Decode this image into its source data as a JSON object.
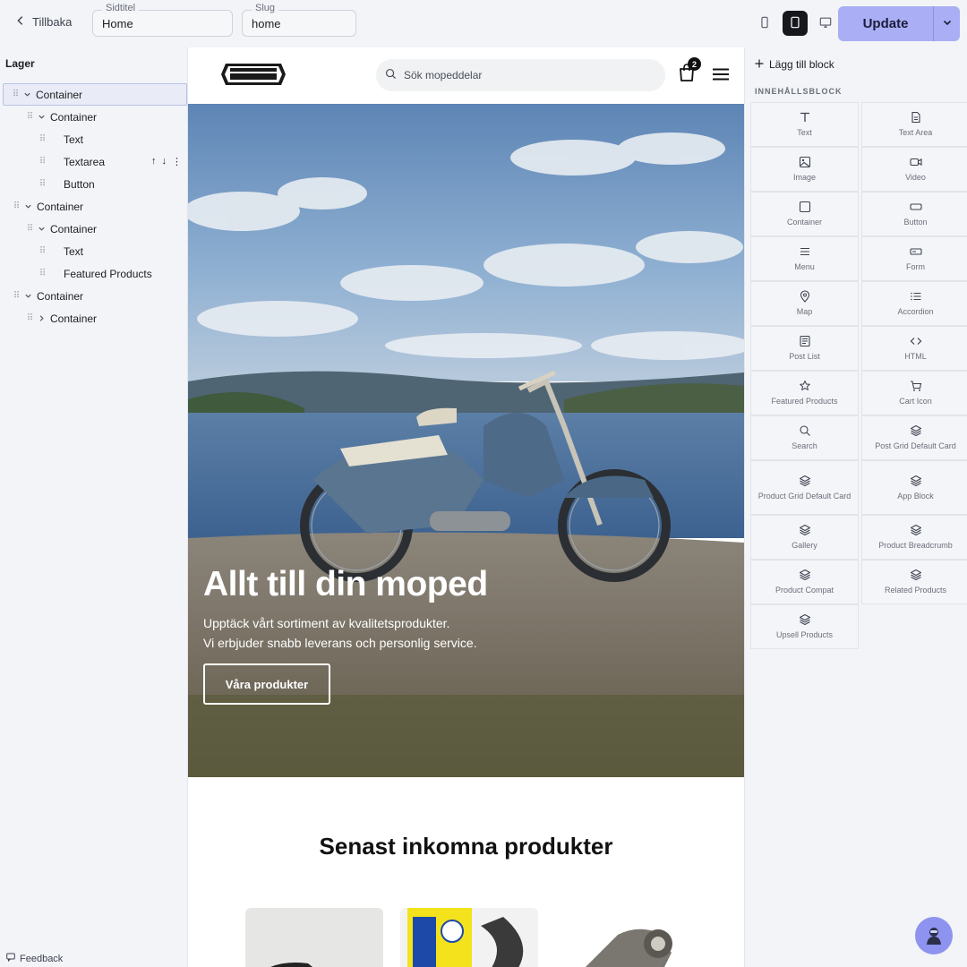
{
  "topbar": {
    "back_label": "Tillbaka",
    "title_field": {
      "label": "Sidtitel",
      "value": "Home"
    },
    "slug_field": {
      "label": "Slug",
      "value": "home"
    },
    "devices": [
      "mobile",
      "tablet",
      "desktop"
    ],
    "active_device": "tablet",
    "update_label": "Update",
    "accent_color": "#a9aef5"
  },
  "layers": {
    "title": "Lager",
    "nodes": [
      {
        "label": "Container",
        "depth": 0,
        "expanded": true,
        "selected": true
      },
      {
        "label": "Container",
        "depth": 1,
        "expanded": true
      },
      {
        "label": "Text",
        "depth": 2
      },
      {
        "label": "Textarea",
        "depth": 2,
        "actions": [
          "↑",
          "↓",
          "⋮"
        ]
      },
      {
        "label": "Button",
        "depth": 2
      },
      {
        "label": "Container",
        "depth": 0,
        "expanded": true
      },
      {
        "label": "Container",
        "depth": 1,
        "expanded": true
      },
      {
        "label": "Text",
        "depth": 2
      },
      {
        "label": "Featured Products",
        "depth": 2
      },
      {
        "label": "Container",
        "depth": 0,
        "expanded": true
      },
      {
        "label": "Container",
        "depth": 1,
        "expanded": false
      }
    ],
    "feedback_label": "Feedback"
  },
  "preview": {
    "search_placeholder": "Sök mopeddelar",
    "cart_count": "2",
    "hero": {
      "title": "Allt till din moped",
      "line1": "Upptäck vårt sortiment av kvalitetsprodukter.",
      "line2": "Vi erbjuder snabb leverans och personlig service.",
      "button": "Våra produkter"
    },
    "section_title": "Senast inkomna produkter"
  },
  "blocks": {
    "add_label": "Lägg till block",
    "heading": "INNEHÅLLSBLOCK",
    "items": [
      {
        "label": "Text",
        "icon": "text-icon"
      },
      {
        "label": "Text Area",
        "icon": "document-icon"
      },
      {
        "label": "Image",
        "icon": "image-icon"
      },
      {
        "label": "Video",
        "icon": "video-icon"
      },
      {
        "label": "Container",
        "icon": "square-icon"
      },
      {
        "label": "Button",
        "icon": "button-icon"
      },
      {
        "label": "Menu",
        "icon": "menu-icon"
      },
      {
        "label": "Form",
        "icon": "form-icon"
      },
      {
        "label": "Map",
        "icon": "map-pin-icon"
      },
      {
        "label": "Accordion",
        "icon": "list-icon"
      },
      {
        "label": "Post List",
        "icon": "newspaper-icon"
      },
      {
        "label": "HTML",
        "icon": "code-icon"
      },
      {
        "label": "Featured Products",
        "icon": "star-icon"
      },
      {
        "label": "Cart Icon",
        "icon": "cart-icon"
      },
      {
        "label": "Search",
        "icon": "search-icon"
      },
      {
        "label": "Post Grid Default Card",
        "icon": "layers-icon"
      },
      {
        "label": "Product Grid Default Card",
        "icon": "layers-icon"
      },
      {
        "label": "App Block",
        "icon": "layers-icon"
      },
      {
        "label": "Gallery",
        "icon": "layers-icon"
      },
      {
        "label": "Product Breadcrumb",
        "icon": "layers-icon"
      },
      {
        "label": "Product Compat",
        "icon": "layers-icon"
      },
      {
        "label": "Related Products",
        "icon": "layers-icon"
      },
      {
        "label": "Upsell Products",
        "icon": "layers-icon"
      }
    ]
  }
}
